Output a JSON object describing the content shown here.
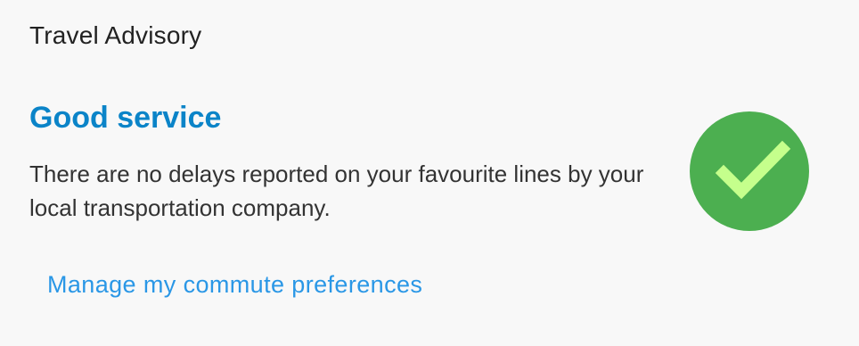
{
  "card": {
    "title": "Travel Advisory",
    "status": {
      "title": "Good service",
      "description": "There are no delays reported on your favourite lines by your local transportation company.",
      "icon": "checkmark-circle-icon",
      "icon_color": "#4caf50",
      "check_color": "#c5ff8c",
      "title_color": "#0b84c8"
    },
    "action": {
      "label": "Manage my commute preferences",
      "color": "#2a97e6"
    }
  }
}
